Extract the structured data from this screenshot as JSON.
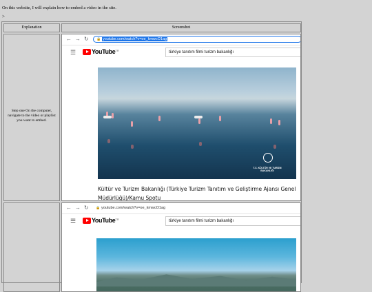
{
  "intro_text": "On this website, I will explain how to embed a video in the site.",
  "marker": ">",
  "table": {
    "headers": {
      "explanation": "Explanation",
      "screenshot": "Screenshot"
    },
    "rows": [
      {
        "explanation": "Step one On the computer, navigate to the video or playlist you want to embed.",
        "browser": {
          "url": "youtube.com/watch?v=oe_kmwcO1ag",
          "url_selected": true
        },
        "youtube": {
          "logo_text": "YouTube",
          "region_code": "TR",
          "search_value": "türkiye tanıtım filmi turizm bakanlığı"
        },
        "video": {
          "watermark": "T.C. KÜLTÜR VE TURİZM BAKANLIĞI",
          "title": "Kültür ve Turizm Bakanlığı (Türkiye Turizm Tanıtım ve Geliştirme Ajansı Genel Müdürlüğü)/Kamu Spotu"
        }
      },
      {
        "explanation": "",
        "browser": {
          "url": "youtube.com/watch?v=oe_kmwcO1ag",
          "url_selected": false
        },
        "youtube": {
          "logo_text": "YouTube",
          "region_code": "TR",
          "search_value": "türkiye tanıtım filmi turizm bakanlığı"
        }
      }
    ]
  },
  "icons": {
    "back": "arrow-left-icon",
    "forward": "arrow-right-icon",
    "reload": "reload-icon",
    "lock": "lock-icon",
    "menu": "hamburger-icon",
    "logo": "youtube-logo-icon"
  },
  "colors": {
    "page_bg": "#d3d3d3",
    "youtube_red": "#ff0000",
    "url_highlight": "#1a73e8"
  }
}
